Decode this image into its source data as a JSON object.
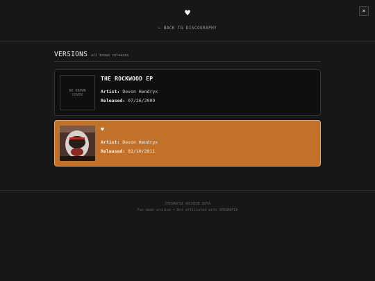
{
  "header": {
    "logo": "♥",
    "back_link": "← BACK TO DISCOGRAPHY",
    "close": "×"
  },
  "section": {
    "title": "VERSIONS",
    "subtitle": "all known releases"
  },
  "releases": [
    {
      "title": "THE ROCKWOOD EP",
      "cover_text": "NO KNOWN COVER",
      "artist_label": "Artist:",
      "artist": "Devon Hendryx",
      "released_label": "Released:",
      "released": "07/26/2009"
    },
    {
      "title": "♥",
      "artist_label": "Artist:",
      "artist": "Devon Hendryx",
      "released_label": "Released:",
      "released": "02/10/2011"
    }
  ],
  "footer": {
    "line1": "JPEGMAFIA ARCHIVE BETA",
    "line2": "Fan-made archive • Not affiliated with JPEGMAFIA"
  }
}
